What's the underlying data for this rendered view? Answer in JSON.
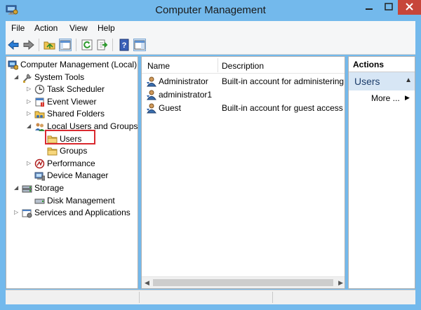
{
  "window": {
    "title": "Computer Management"
  },
  "menubar": {
    "items": [
      "File",
      "Action",
      "View",
      "Help"
    ]
  },
  "toolbar": {
    "buttons": [
      "back-icon",
      "forward-icon",
      "up-folder-icon",
      "show-hide-tree-icon",
      "refresh-icon",
      "export-list-icon",
      "help-icon",
      "show-hide-action-pane-icon"
    ]
  },
  "tree": {
    "items": [
      {
        "label": "Computer Management (Local)",
        "level": 0,
        "expander": "",
        "icon": "computer-management-icon"
      },
      {
        "label": "System Tools",
        "level": 1,
        "expander": "expanded",
        "icon": "system-tools-icon"
      },
      {
        "label": "Task Scheduler",
        "level": 2,
        "expander": "collapsed",
        "icon": "task-scheduler-icon"
      },
      {
        "label": "Event Viewer",
        "level": 2,
        "expander": "collapsed",
        "icon": "event-viewer-icon"
      },
      {
        "label": "Shared Folders",
        "level": 2,
        "expander": "collapsed",
        "icon": "shared-folders-icon"
      },
      {
        "label": "Local Users and Groups",
        "level": 2,
        "expander": "expanded",
        "icon": "local-users-groups-icon"
      },
      {
        "label": "Users",
        "level": 3,
        "expander": "",
        "icon": "folder-icon",
        "selected": true
      },
      {
        "label": "Groups",
        "level": 3,
        "expander": "",
        "icon": "folder-icon"
      },
      {
        "label": "Performance",
        "level": 2,
        "expander": "collapsed",
        "icon": "performance-icon"
      },
      {
        "label": "Device Manager",
        "level": 2,
        "expander": "",
        "icon": "device-manager-icon"
      },
      {
        "label": "Storage",
        "level": 1,
        "expander": "expanded",
        "icon": "storage-icon"
      },
      {
        "label": "Disk Management",
        "level": 2,
        "expander": "",
        "icon": "disk-management-icon"
      },
      {
        "label": "Services and Applications",
        "level": 1,
        "expander": "collapsed",
        "icon": "services-applications-icon"
      }
    ]
  },
  "list": {
    "columns": [
      "Name",
      "Description"
    ],
    "rows": [
      {
        "name": "Administrator",
        "description": "Built-in account for administering"
      },
      {
        "name": "administrator1",
        "description": ""
      },
      {
        "name": "Guest",
        "description": "Built-in account for guest access t"
      }
    ]
  },
  "actions": {
    "title": "Actions",
    "section": "Users",
    "items": [
      "More ..."
    ]
  },
  "colors": {
    "title_bar": "#73b9ec",
    "close_button": "#c7463a",
    "highlight_box": "#d9292f",
    "action_section_bg": "#d7e6f5"
  }
}
